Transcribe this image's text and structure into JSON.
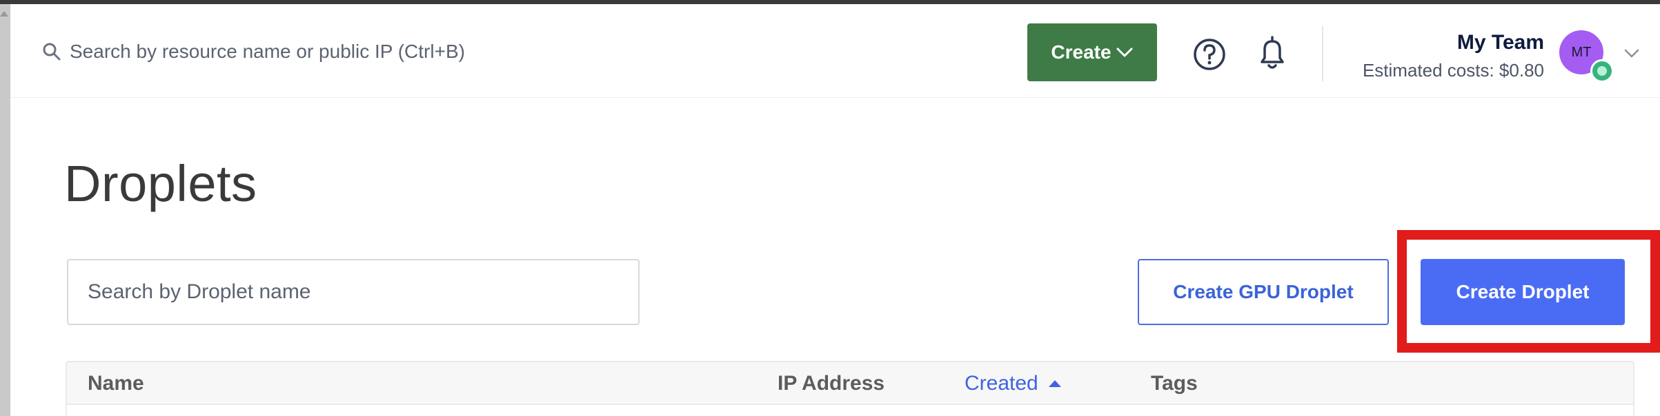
{
  "header": {
    "search_placeholder": "Search by resource name or public IP (Ctrl+B)",
    "create_label": "Create",
    "team_name": "My Team",
    "estimated_costs": "Estimated costs: $0.80",
    "avatar_initials": "MT"
  },
  "main": {
    "page_title": "Droplets",
    "search_placeholder": "Search by Droplet name",
    "create_gpu_label": "Create GPU Droplet",
    "create_droplet_label": "Create Droplet"
  },
  "table": {
    "columns": [
      "Name",
      "IP Address",
      "Created",
      "Tags"
    ],
    "sorted_column": "Created",
    "sort_direction": "ascending"
  },
  "colors": {
    "create_green": "#3e7b46",
    "primary_blue": "#4a6cf5",
    "highlight_red": "#e21b1b",
    "avatar_purple": "#a45cf2"
  }
}
